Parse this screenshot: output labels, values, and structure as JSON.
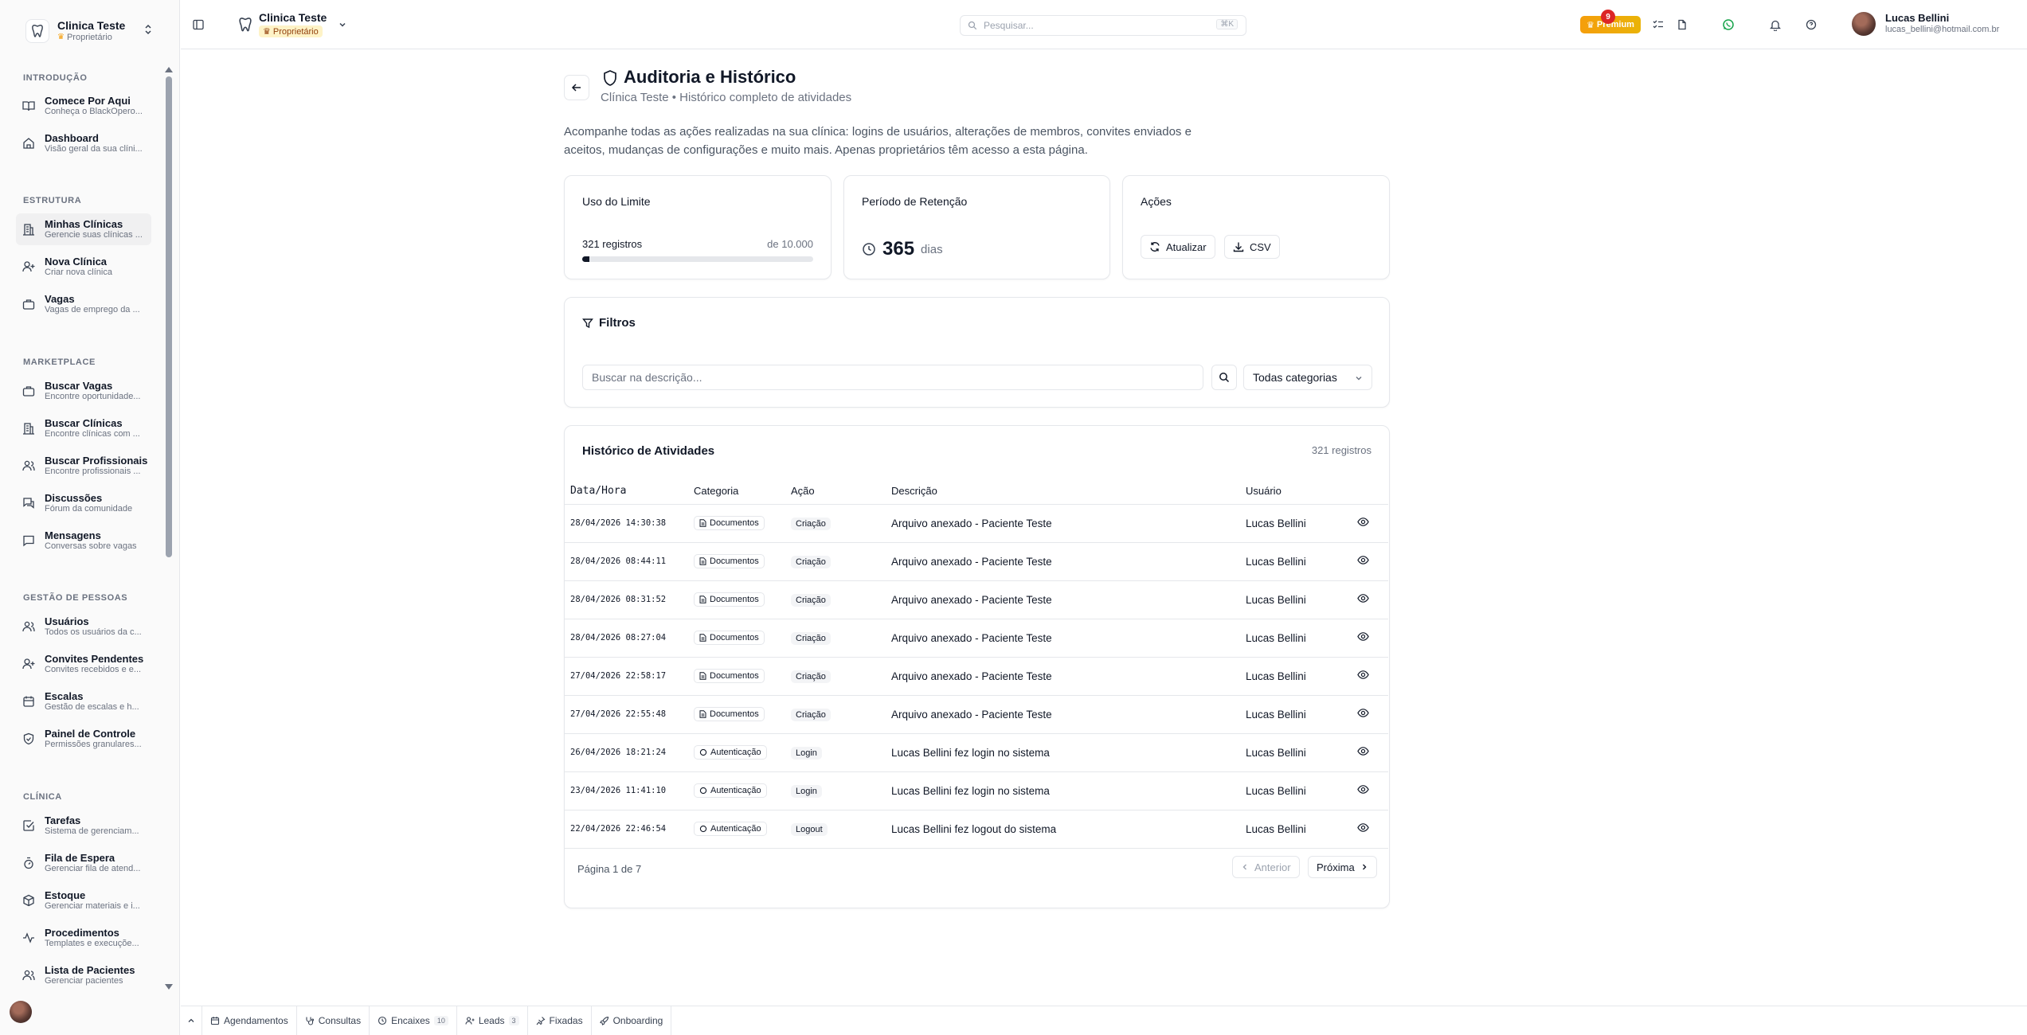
{
  "sidebar": {
    "clinic_name": "Clinica Teste",
    "clinic_role": "Proprietário",
    "sections": [
      {
        "label": "INTRODUÇÃO"
      },
      {
        "label": "ESTRUTURA"
      },
      {
        "label": "MARKETPLACE"
      },
      {
        "label": "GESTÃO DE PESSOAS"
      },
      {
        "label": "CLÍNICA"
      }
    ],
    "items": [
      {
        "title": "Comece Por Aqui",
        "sub": "Conheça o BlackOpero..."
      },
      {
        "title": "Dashboard",
        "sub": "Visão geral da sua clíni..."
      },
      {
        "title": "Minhas Clínicas",
        "sub": "Gerencie suas clínicas ..."
      },
      {
        "title": "Nova Clínica",
        "sub": "Criar nova clínica"
      },
      {
        "title": "Vagas",
        "sub": "Vagas de emprego da ..."
      },
      {
        "title": "Buscar Vagas",
        "sub": "Encontre oportunidade..."
      },
      {
        "title": "Buscar Clínicas",
        "sub": "Encontre clínicas com ..."
      },
      {
        "title": "Buscar Profissionais",
        "sub": "Encontre profissionais ..."
      },
      {
        "title": "Discussões",
        "sub": "Fórum da comunidade"
      },
      {
        "title": "Mensagens",
        "sub": "Conversas sobre vagas"
      },
      {
        "title": "Usuários",
        "sub": "Todos os usuários da c..."
      },
      {
        "title": "Convites Pendentes",
        "sub": "Convites recebidos e e..."
      },
      {
        "title": "Escalas",
        "sub": "Gestão de escalas e h..."
      },
      {
        "title": "Painel de Controle",
        "sub": "Permissões granulares..."
      },
      {
        "title": "Tarefas",
        "sub": "Sistema de gerenciam..."
      },
      {
        "title": "Fila de Espera",
        "sub": "Gerenciar fila de atend..."
      },
      {
        "title": "Estoque",
        "sub": "Gerenciar materiais e i..."
      },
      {
        "title": "Procedimentos",
        "sub": "Templates e execuçõe..."
      },
      {
        "title": "Lista de Pacientes",
        "sub": "Gerenciar pacientes"
      }
    ]
  },
  "topbar": {
    "clinic_name": "Clinica Teste",
    "clinic_role": "Proprietário",
    "search_placeholder": "Pesquisar...",
    "search_shortcut": "⌘K",
    "premium_label": "Premium",
    "notification_count": "9",
    "user_name": "Lucas Bellini",
    "user_email": "lucas_bellini@hotmail.com.br"
  },
  "page": {
    "title": "Auditoria e Histórico",
    "subtitle": "Clínica Teste • Histórico completo de atividades",
    "description": "Acompanhe todas as ações realizadas na sua clínica: logins de usuários, alterações de membros, convites enviados e aceitos, mudanças de configurações e muito mais. Apenas proprietários têm acesso a esta página."
  },
  "usage_card": {
    "title": "Uso do Limite",
    "count_label": "321 registros",
    "limit_label": "de 10.000",
    "usage_fraction": 0.0321
  },
  "retention_card": {
    "title": "Período de Retenção",
    "value": "365",
    "unit": "dias"
  },
  "actions_card": {
    "title": "Ações",
    "refresh_label": "Atualizar",
    "csv_label": "CSV"
  },
  "filters": {
    "title": "Filtros",
    "search_placeholder": "Buscar na descrição...",
    "category_selected": "Todas categorias"
  },
  "history": {
    "title": "Histórico de Atividades",
    "count_label": "321 registros",
    "columns": [
      "Data/Hora",
      "Categoria",
      "Ação",
      "Descrição",
      "Usuário"
    ],
    "rows": [
      {
        "date": "28/04/2026 14:30:38",
        "category": "Documentos",
        "action": "Criação",
        "description": "Arquivo anexado - Paciente Teste",
        "user": "Lucas Bellini"
      },
      {
        "date": "28/04/2026 08:44:11",
        "category": "Documentos",
        "action": "Criação",
        "description": "Arquivo anexado - Paciente Teste",
        "user": "Lucas Bellini"
      },
      {
        "date": "28/04/2026 08:31:52",
        "category": "Documentos",
        "action": "Criação",
        "description": "Arquivo anexado - Paciente Teste",
        "user": "Lucas Bellini"
      },
      {
        "date": "28/04/2026 08:27:04",
        "category": "Documentos",
        "action": "Criação",
        "description": "Arquivo anexado - Paciente Teste",
        "user": "Lucas Bellini"
      },
      {
        "date": "27/04/2026 22:58:17",
        "category": "Documentos",
        "action": "Criação",
        "description": "Arquivo anexado - Paciente Teste",
        "user": "Lucas Bellini"
      },
      {
        "date": "27/04/2026 22:55:48",
        "category": "Documentos",
        "action": "Criação",
        "description": "Arquivo anexado - Paciente Teste",
        "user": "Lucas Bellini"
      },
      {
        "date": "26/04/2026 18:21:24",
        "category": "Autenticação",
        "action": "Login",
        "description": "Lucas Bellini fez login no sistema",
        "user": "Lucas Bellini"
      },
      {
        "date": "23/04/2026 11:41:10",
        "category": "Autenticação",
        "action": "Login",
        "description": "Lucas Bellini fez login no sistema",
        "user": "Lucas Bellini"
      },
      {
        "date": "22/04/2026 22:46:54",
        "category": "Autenticação",
        "action": "Logout",
        "description": "Lucas Bellini fez logout do sistema",
        "user": "Lucas Bellini"
      }
    ],
    "pagination": {
      "page_label": "Página 1 de 7",
      "prev_label": "Anterior",
      "next_label": "Próxima"
    }
  },
  "dock": {
    "items": [
      {
        "label": "Agendamentos",
        "count": ""
      },
      {
        "label": "Consultas",
        "count": ""
      },
      {
        "label": "Encaixes",
        "count": "10"
      },
      {
        "label": "Leads",
        "count": "3"
      },
      {
        "label": "Fixadas",
        "count": ""
      },
      {
        "label": "Onboarding",
        "count": ""
      }
    ]
  },
  "colors": {
    "accent": "#111827",
    "premium": "#f59e0b",
    "notification": "#dc2626"
  }
}
